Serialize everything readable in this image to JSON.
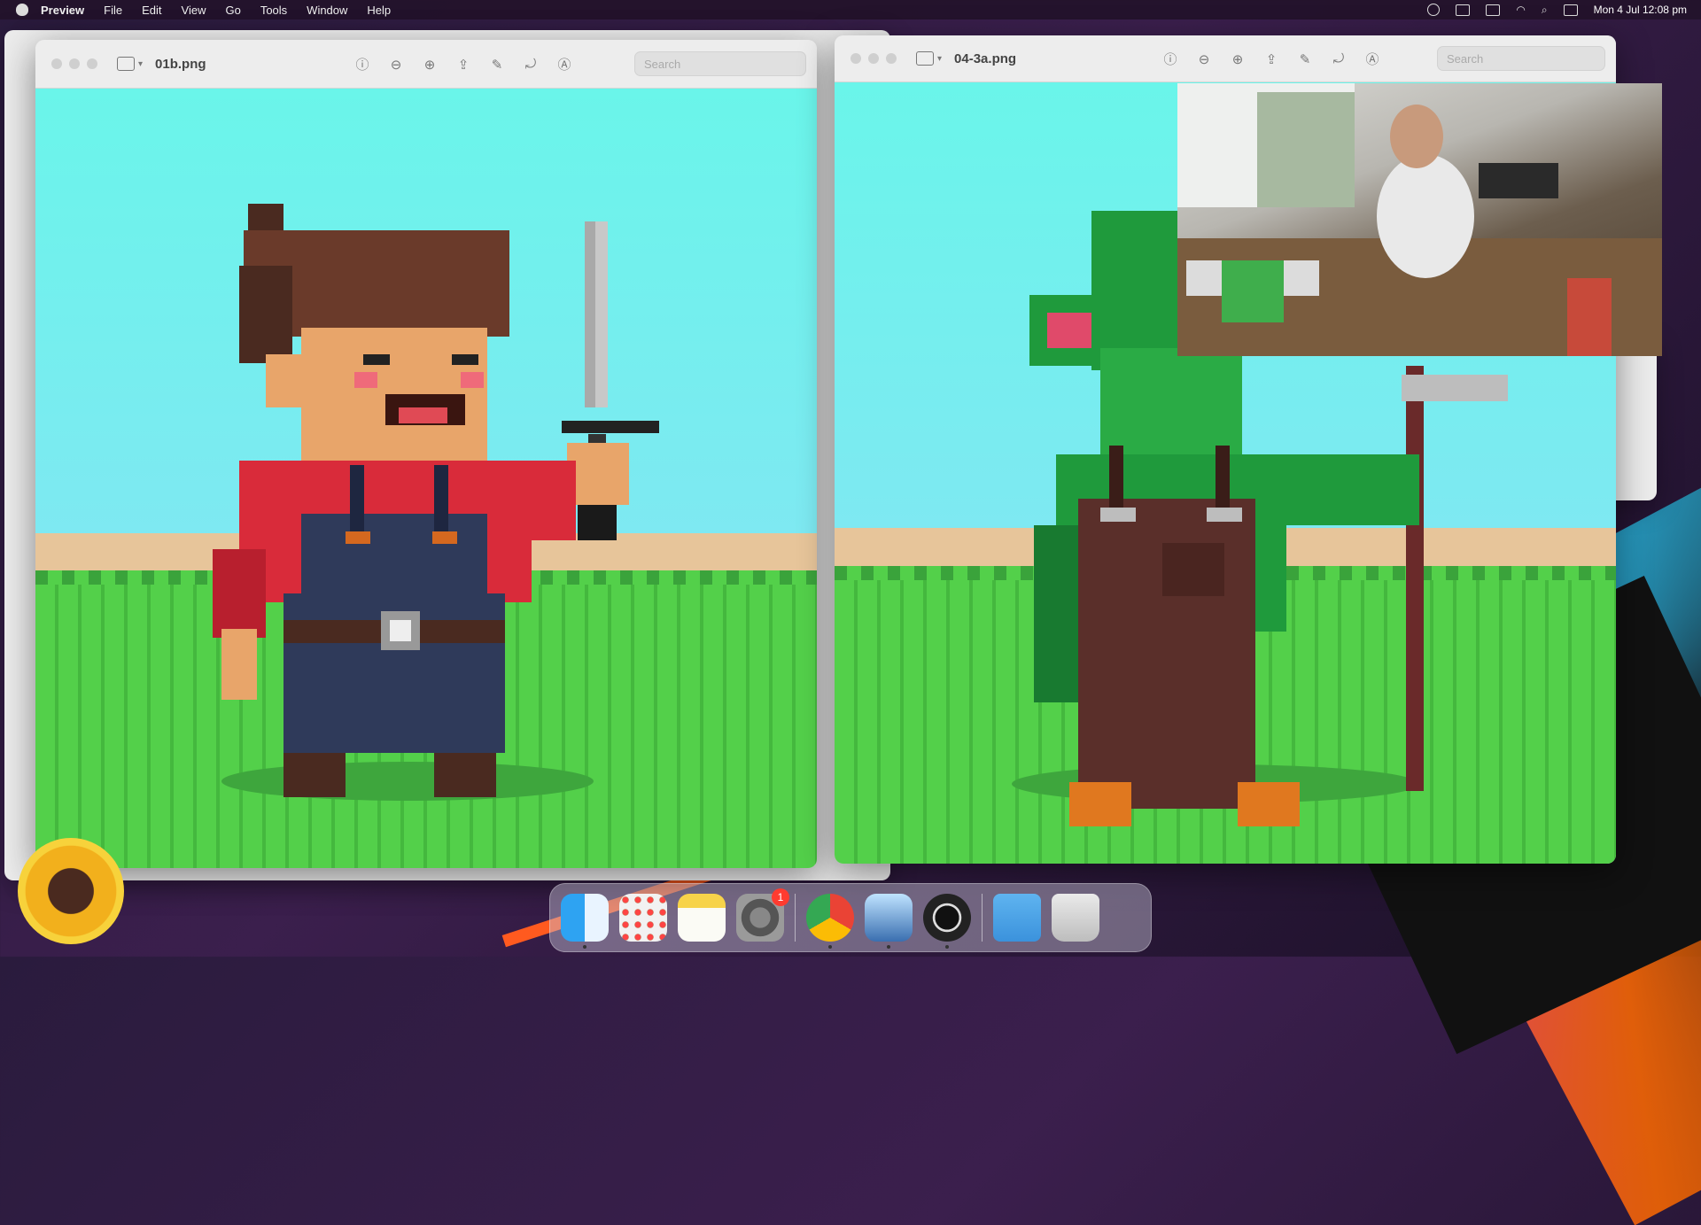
{
  "menubar": {
    "app": "Preview",
    "items": [
      "File",
      "Edit",
      "View",
      "Go",
      "Tools",
      "Window",
      "Help"
    ],
    "clock": "Mon 4 Jul  12:08 pm"
  },
  "window_left": {
    "title": "01b.png",
    "search_placeholder": "Search"
  },
  "window_right": {
    "title": "04-3a.png",
    "search_placeholder": "Search"
  },
  "dock": {
    "apps": [
      "finder",
      "launchpad",
      "notes",
      "system-preferences",
      "chrome",
      "preview",
      "obs",
      "folder",
      "trash"
    ],
    "system_preferences_badge": "1"
  },
  "colors": {
    "sky": "#6af5ea",
    "grass": "#53d04a",
    "sand": "#e7c59a",
    "boy_shirt": "#d92b3a",
    "boy_overalls": "#2f3a5a",
    "goblin_skin": "#1f9a3c",
    "goblin_overalls": "#5a2f2a"
  }
}
